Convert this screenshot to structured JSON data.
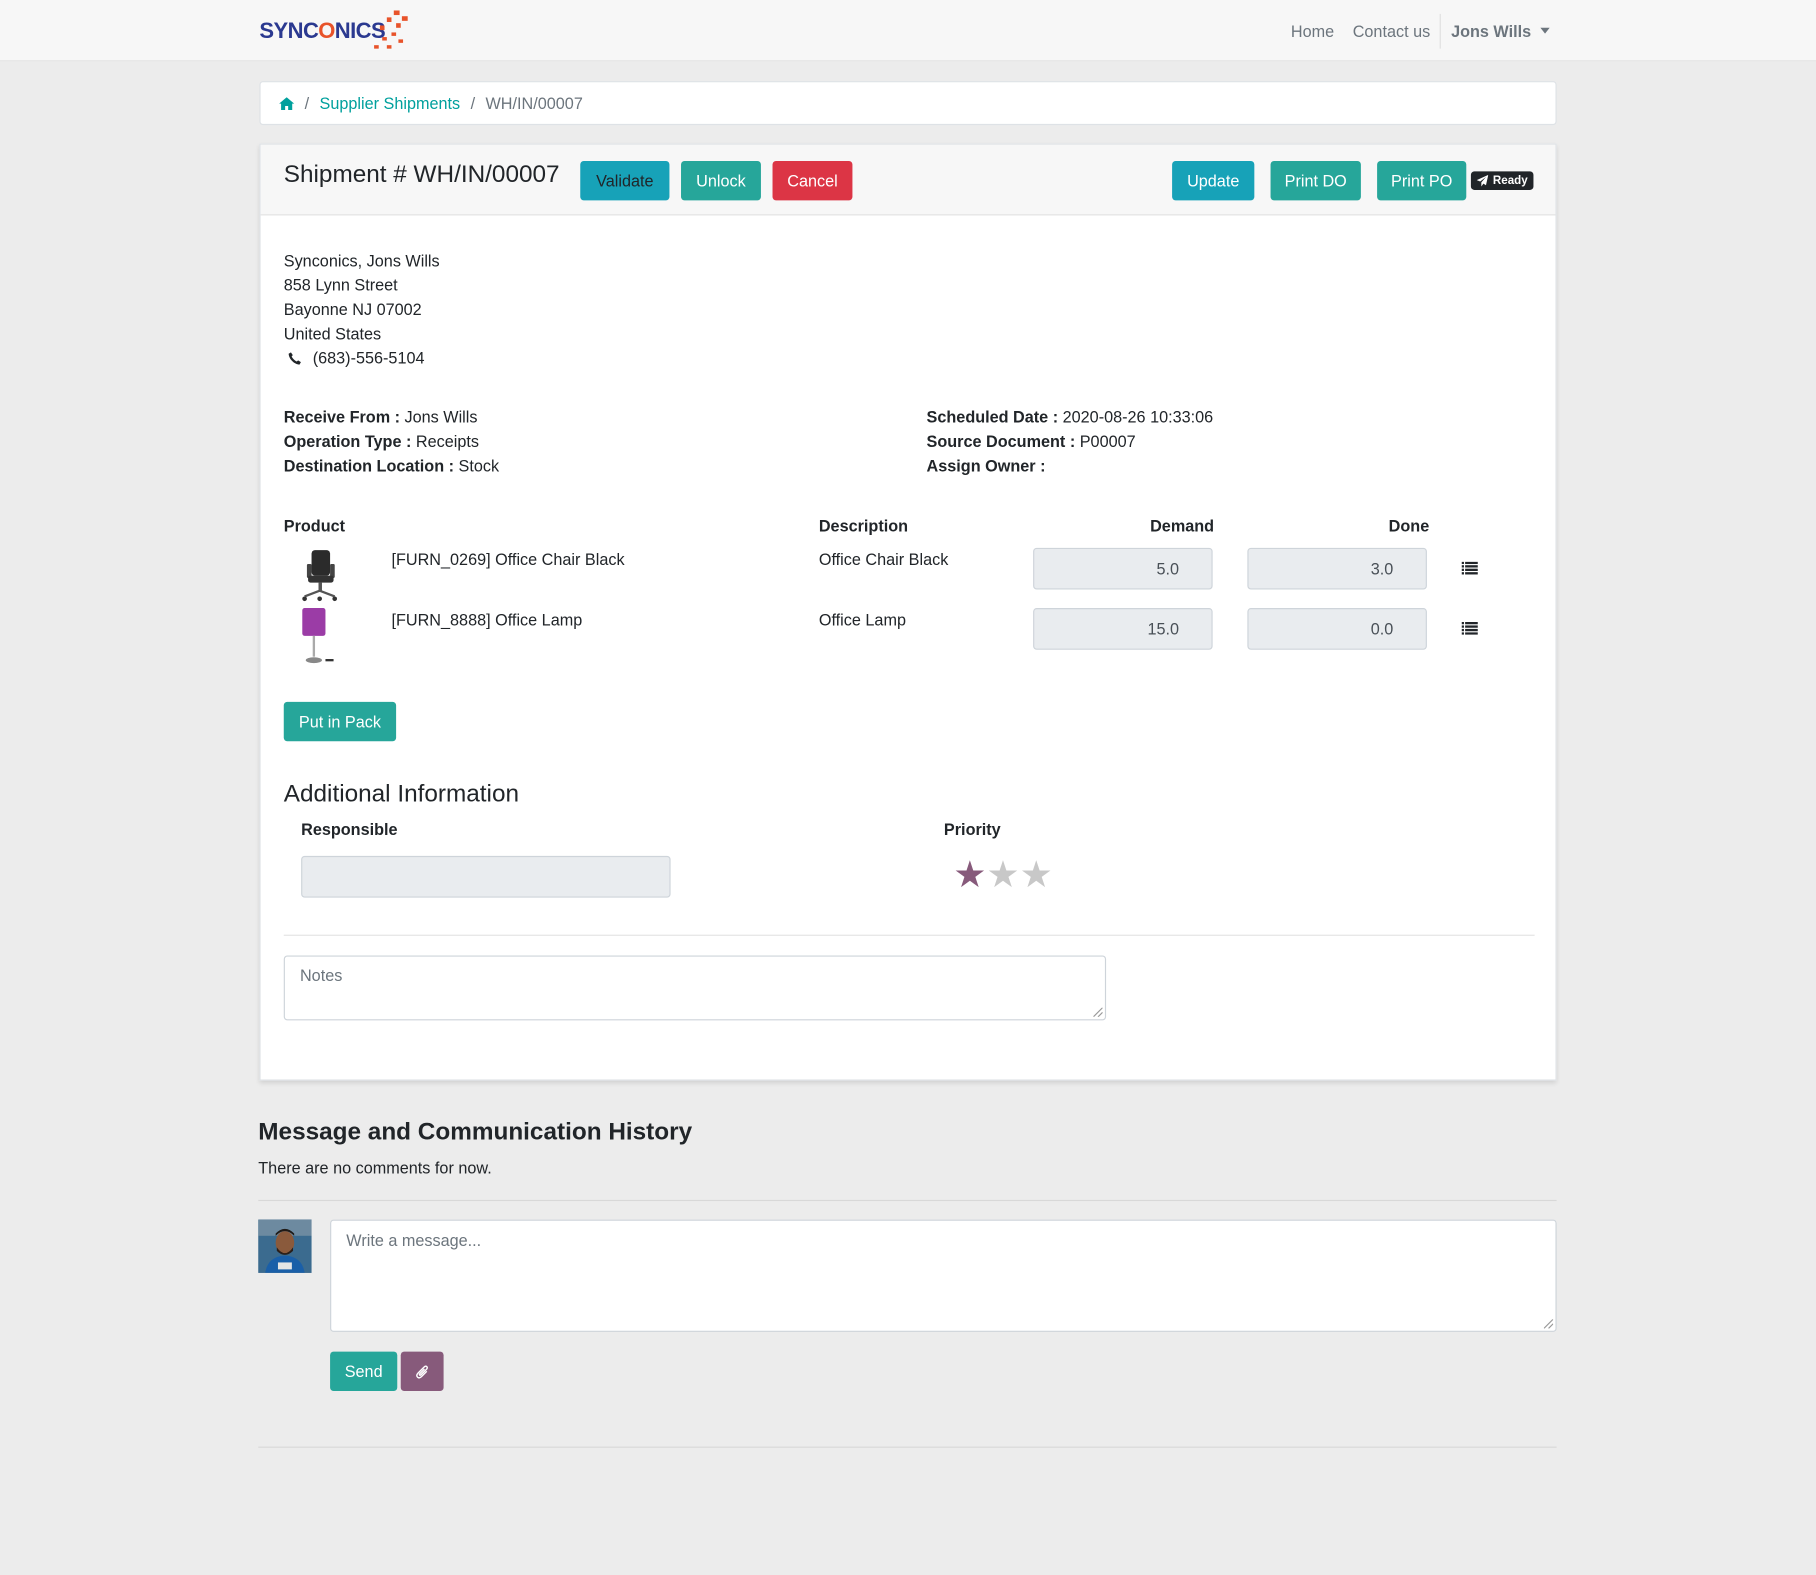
{
  "nav": {
    "logo_text_a": "SYNC",
    "logo_text_o": "O",
    "logo_text_b": "NICS",
    "home": "Home",
    "contact": "Contact us",
    "user": "Jons Wills"
  },
  "breadcrumb": {
    "link": "Supplier Shipments",
    "current": "WH/IN/00007"
  },
  "header": {
    "title": "Shipment # WH/IN/00007",
    "validate": "Validate",
    "unlock": "Unlock",
    "cancel": "Cancel",
    "update": "Update",
    "print_do": "Print DO",
    "print_po": "Print PO",
    "status": "Ready"
  },
  "address": {
    "name": "Synconics, Jons Wills",
    "street": "858 Lynn Street",
    "city": "Bayonne NJ 07002",
    "country": "United States",
    "phone": "(683)-556-5104"
  },
  "info_left": {
    "receive_label": "Receive From :",
    "receive_value": "Jons Wills",
    "optype_label": "Operation Type :",
    "optype_value": "Receipts",
    "dest_label": "Destination Location :",
    "dest_value": "Stock"
  },
  "info_right": {
    "sched_label": "Scheduled Date :",
    "sched_value": "2020-08-26 10:33:06",
    "source_label": "Source Document :",
    "source_value": "P00007",
    "owner_label": "Assign Owner :"
  },
  "table": {
    "headers": {
      "product": "Product",
      "description": "Description",
      "demand": "Demand",
      "done": "Done"
    },
    "rows": [
      {
        "product": "[FURN_0269] Office Chair Black",
        "description": "Office Chair Black",
        "demand": "5.0",
        "done": "3.0"
      },
      {
        "product": "[FURN_8888] Office Lamp",
        "description": "Office Lamp",
        "demand": "15.0",
        "done": "0.0"
      }
    ]
  },
  "put_in_pack": "Put in Pack",
  "additional": {
    "title": "Additional Information",
    "responsible_label": "Responsible",
    "priority_label": "Priority",
    "priority": 1,
    "priority_max": 3
  },
  "notes_placeholder": "Notes",
  "messages": {
    "title": "Message and Communication History",
    "empty": "There are no comments for now.",
    "placeholder": "Write a message...",
    "send": "Send"
  },
  "colors": {
    "primary": "#00a09d",
    "info": "#17a2b8",
    "teal": "#26a69a",
    "danger": "#dc3545",
    "odoo_purple": "#875a7b"
  }
}
